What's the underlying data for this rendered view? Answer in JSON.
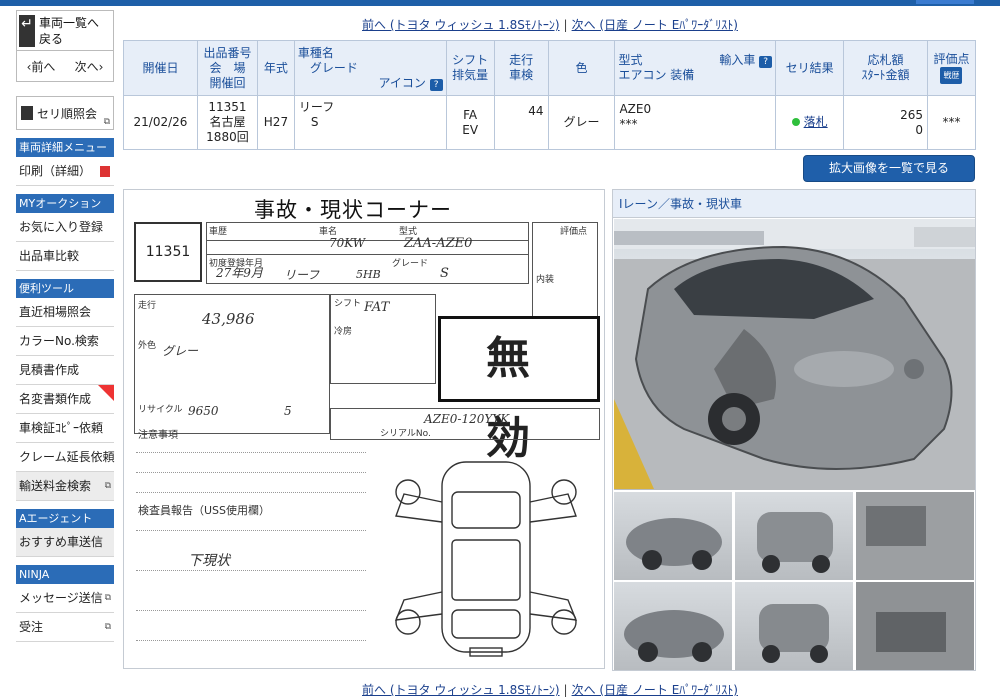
{
  "colors": {
    "accent": "#1e5fa8",
    "sold_dot": "#2fbf3c"
  },
  "sidebar": {
    "back_label_1": "車両一覧へ",
    "back_label_2": "戻る",
    "prev": "‹前へ",
    "next": "次へ›",
    "seri_label": "セリ順照会",
    "sections": [
      {
        "head": "車両詳細メニュー",
        "items": [
          "印刷（詳細）"
        ]
      },
      {
        "head": "MYオークション",
        "items": [
          "お気に入り登録",
          "出品車比較"
        ]
      },
      {
        "head": "便利ツール",
        "items": [
          "直近相場照会",
          "カラーNo.検索",
          "見積書作成",
          "名変書類作成",
          "車検証ｺﾋﾟｰ依頼",
          "クレーム延長依頼",
          "輸送料金検索"
        ]
      },
      {
        "head": "Aエージェント",
        "items": [
          "おすすめ車送信"
        ]
      },
      {
        "head": "NINJA",
        "items": [
          "メッセージ送信",
          "受注"
        ]
      }
    ]
  },
  "nav": {
    "prev_link": "前へ (トヨタ ウィッシュ 1.8Sﾓﾉﾄｰﾝ)",
    "next_link": "次へ (日産 ノート Eﾊﾟﾜｰﾀﾞﾘｽﾄ)",
    "separator": "|"
  },
  "table": {
    "headers": {
      "date": "開催日",
      "lot_1": "出品番号",
      "lot_2": "会　場",
      "lot_3": "開催回",
      "year": "年式",
      "model_1": "車種名",
      "model_2": "グレード",
      "model_3": "アイコン",
      "shift_1": "シフト",
      "shift_2": "排気量",
      "mileage_1": "走行",
      "mileage_2": "車検",
      "color": "色",
      "type_1": "型式",
      "type_2": "輸入車",
      "type_3": "エアコン 装備",
      "result": "セリ結果",
      "price_1": "応札額",
      "price_2": "ｽﾀｰﾄ金額",
      "score": "評価点",
      "score_badge": "戦歴"
    },
    "row": {
      "date": "21/02/26",
      "lot": "11351",
      "venue": "名古屋",
      "session": "1880回",
      "year": "H27",
      "model": "リーフ",
      "grade": "S",
      "shift": "FA",
      "fuel": "EV",
      "mileage": "44",
      "color": "グレー",
      "type": "AZE0",
      "equip": "***",
      "result": "落札",
      "bid": "265",
      "start": "0",
      "score": "***"
    }
  },
  "buttons": {
    "enlarge": "拡大画像を一覧で見る"
  },
  "sheet": {
    "title": "事故・現状コーナー",
    "lot": "11351",
    "void_stamp": "無　効",
    "labels": {
      "car_history": "車歴",
      "car_name": "車名",
      "type": "型式",
      "model_year": "初度登録年月",
      "grade": "グレード",
      "mileage": "走行",
      "color": "外色",
      "shift": "シフト",
      "aircon": "冷房",
      "inspection": "検査員報告（USS使用欄）",
      "recycle": "リサイクル",
      "notes": "注意事項",
      "score": "評価点",
      "exterior": "内装",
      "serial": "シリアルNo."
    },
    "handwriting": {
      "power": "70KW",
      "type": "ZAA-AZE0",
      "year": "27年9月",
      "name": "リーフ",
      "doors": "5HB",
      "grade": "S",
      "shift": "FAT",
      "mileage": "43,986",
      "color": "グレー",
      "recycle": "9650",
      "seats": "5",
      "frame": "AZE0-120YYK",
      "report": "下現状"
    }
  },
  "photos": {
    "title": "Iレーン／事故・現状車"
  }
}
